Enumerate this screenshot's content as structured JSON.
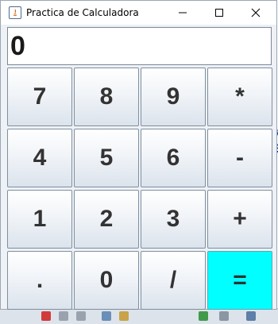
{
  "window": {
    "title": "Practica de Calculadora",
    "controls": {
      "minimize": "—",
      "maximize": "☐",
      "close": "✕"
    }
  },
  "display": {
    "value": "0"
  },
  "keypad": {
    "rows": [
      [
        "7",
        "8",
        "9",
        "*"
      ],
      [
        "4",
        "5",
        "6",
        "-"
      ],
      [
        "1",
        "2",
        "3",
        "+"
      ],
      [
        ".",
        "0",
        "/",
        "="
      ]
    ]
  },
  "colors": {
    "equals_key": "#00ffff"
  }
}
